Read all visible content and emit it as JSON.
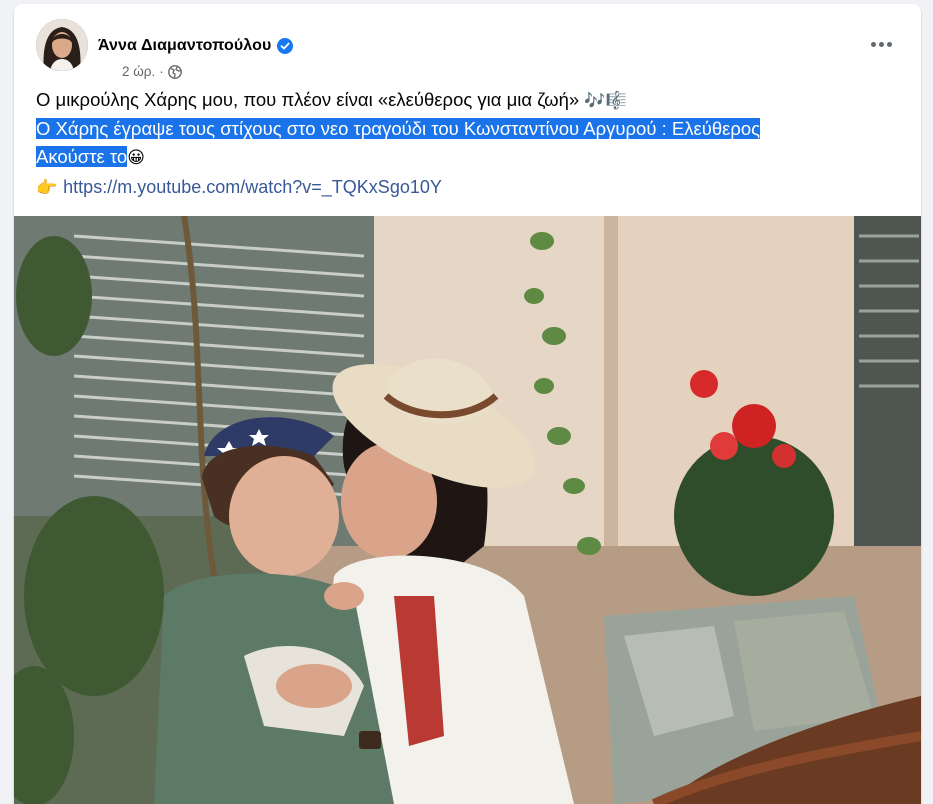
{
  "post": {
    "author_name": "Άννα Διαμαντοπούλου",
    "timestamp": "2 ώρ.",
    "meta_separator": "·",
    "audience_icon": "globe-icon",
    "verified_icon": "verified-badge-icon",
    "more_icon": "more-options-icon",
    "text_line1": "Ο μικρούλης Χάρης μου, που πλέον είναι «ελεύθερος για μια ζωή» ",
    "text_line1_emoji": "🎶🎼",
    "text_line2": "Ο Χάρης έγραψε τους στίχους στο νεο τραγούδι του Κωνσταντίνου Αργυρού : Ελεύθερος",
    "text_line3": "Ακούστε το",
    "text_line3_emoji": "😀",
    "link_emoji": "👉",
    "link_url": "https://m.youtube.com/watch?v=_TQKxSgo10Y",
    "photo_icon": "post-photo"
  },
  "colors": {
    "link": "#385898",
    "selection": "#1a73e8",
    "verified": "#1877f2",
    "secondary_text": "#65676b"
  }
}
